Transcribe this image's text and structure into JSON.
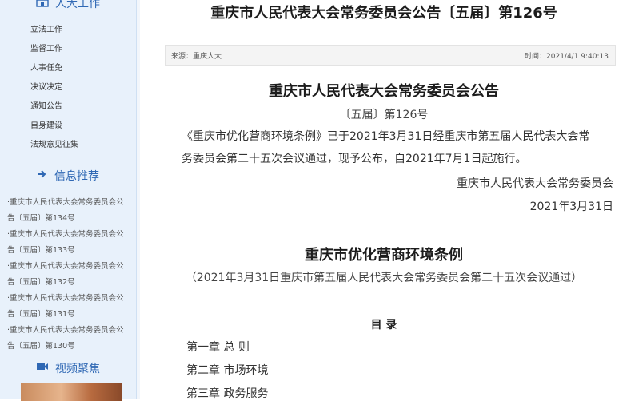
{
  "sidebar": {
    "section1_title": "人大工作",
    "section1_icon": "building-icon",
    "links": [
      "立法工作",
      "监督工作",
      "人事任免",
      "决议决定",
      "通知公告",
      "自身建设",
      "法规意见征集"
    ],
    "section2_title": "信息推荐",
    "section2_icon": "arrow-right-icon",
    "recommended": [
      {
        "line1": "·重庆市人民代表大会常务委员会公",
        "line2": "告〔五届〕第134号"
      },
      {
        "line1": "·重庆市人民代表大会常务委员会公",
        "line2": "告〔五届〕第133号"
      },
      {
        "line1": "·重庆市人民代表大会常务委员会公",
        "line2": "告〔五届〕第132号"
      },
      {
        "line1": "·重庆市人民代表大会常务委员会公",
        "line2": "告〔五届〕第131号"
      },
      {
        "line1": "·重庆市人民代表大会常务委员会公",
        "line2": "告〔五届〕第130号"
      }
    ],
    "section3_title": "视频聚焦",
    "section3_icon": "video-camera-icon"
  },
  "article": {
    "page_title": "重庆市人民代表大会常务委员会公告〔五届〕第126号",
    "source": "来源：重庆人大",
    "time": "时间：2021/4/1 9:40:13",
    "heading": "重庆市人民代表大会常务委员会公告",
    "number": "〔五届〕第126号",
    "body_line1": "《重庆市优化营商环境条例》已于2021年3月31日经重庆市第五届人民代表大会常",
    "body_line2": "务委员会第二十五次会议通过，现予公布，自2021年7月1日起施行。",
    "signature": "重庆市人民代表大会常务委员会",
    "date": "2021年3月31日",
    "regulation_title": "重庆市优化营商环境条例",
    "regulation_subtitle": "（2021年3月31日重庆市第五届人民代表大会常务委员会第二十五次会议通过）",
    "toc_title": "目 录",
    "toc": [
      "第一章 总 则",
      "第二章 市场环境",
      "第三章 政务服务"
    ]
  },
  "colors": {
    "accent": "#2f68b4",
    "sidebar_bg": "#e8f1fb"
  }
}
